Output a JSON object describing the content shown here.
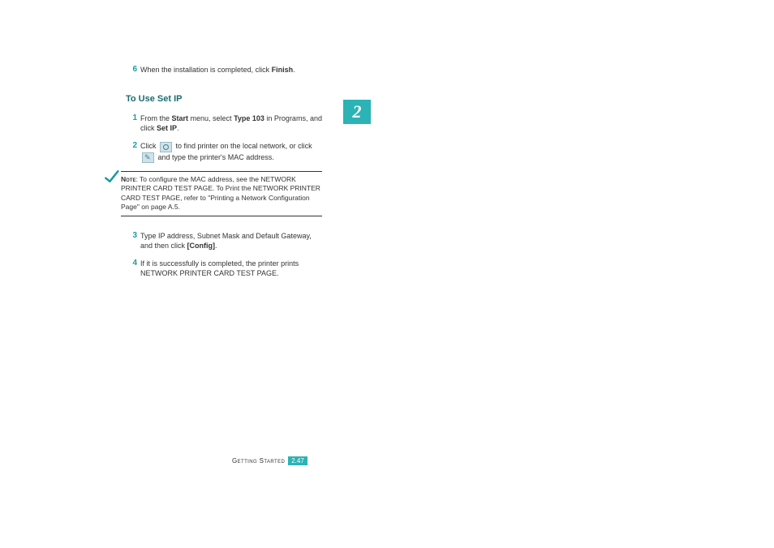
{
  "step6": {
    "num": "6",
    "t1": "When the installation is completed, click ",
    "b1": "Finish",
    "t2": "."
  },
  "heading": "To Use Set IP",
  "step1": {
    "num": "1",
    "t1": "From the ",
    "b1": "Start",
    "t2": " menu, select ",
    "b2": "Type 103",
    "t3": "  in Programs, and click ",
    "b3": "Set IP",
    "t4": "."
  },
  "step2": {
    "num": "2",
    "t1": "Click  ",
    "t2": "  to find printer on the local network, or click  ",
    "t3": "  and type the printer's MAC address."
  },
  "note": {
    "label": "Note",
    "body": ": To configure the MAC address, see the NETWORK PRINTER CARD TEST PAGE. To Print the NETWORK PRINTER CARD TEST PAGE, refer to \"Printing a Network Configuration Page\" on page A.5."
  },
  "step3": {
    "num": "3",
    "t1": "Type IP address, Subnet Mask and Default Gateway, and then click ",
    "b1": "[Config]",
    "t2": "."
  },
  "step4": {
    "num": "4",
    "t1": "If it is successfully is completed, the printer prints NETWORK PRINTER CARD TEST PAGE."
  },
  "chapter": "2",
  "footer": {
    "label": "Getting Started",
    "page": "2.47"
  }
}
